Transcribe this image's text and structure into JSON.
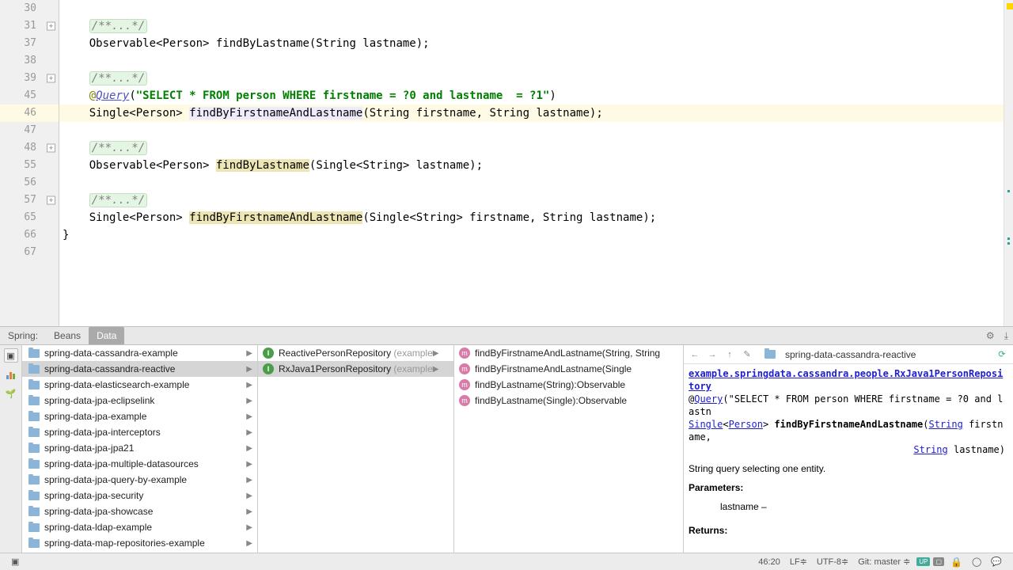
{
  "gutter": {
    "lines": [
      {
        "n": "30",
        "fold": false
      },
      {
        "n": "31",
        "fold": true
      },
      {
        "n": "37",
        "fold": false
      },
      {
        "n": "38",
        "fold": false
      },
      {
        "n": "39",
        "fold": true
      },
      {
        "n": "45",
        "fold": false
      },
      {
        "n": "46",
        "fold": false,
        "lit": true,
        "bulb": true
      },
      {
        "n": "47",
        "fold": false
      },
      {
        "n": "48",
        "fold": true
      },
      {
        "n": "55",
        "fold": false
      },
      {
        "n": "56",
        "fold": false
      },
      {
        "n": "57",
        "fold": true
      },
      {
        "n": "65",
        "fold": false
      },
      {
        "n": "66",
        "fold": false
      },
      {
        "n": "67",
        "fold": false
      }
    ]
  },
  "code": {
    "fold_comment": "/**...*/",
    "l37": "Observable<Person> findByLastname(String lastname);",
    "l45_ann": "@",
    "l45_q": "Query",
    "l45_paren": "(",
    "l45_str": "\"SELECT * FROM person WHERE firstname = ?0 and lastname  = ?1\"",
    "l45_close": ")",
    "l46_pre": "Single<Person> ",
    "l46_m": "findByFirstnameAndLastname",
    "l46_post": "(String firstname, String lastname);",
    "l55_pre": "Observable<Person> ",
    "l55_m": "findByLastname",
    "l55_post": "(Single<String> lastname);",
    "l65_pre": "Single<Person> ",
    "l65_m": "findByFirstnameAndLastname",
    "l65_post": "(Single<String> firstname, String lastname);",
    "l66": "}",
    "indent": "    "
  },
  "tabs": {
    "spring": "Spring:",
    "beans": "Beans",
    "data": "Data"
  },
  "tree": [
    "spring-data-cassandra-example",
    "spring-data-cassandra-reactive",
    "spring-data-elasticsearch-example",
    "spring-data-jpa-eclipselink",
    "spring-data-jpa-example",
    "spring-data-jpa-interceptors",
    "spring-data-jpa-jpa21",
    "spring-data-jpa-multiple-datasources",
    "spring-data-jpa-query-by-example",
    "spring-data-jpa-security",
    "spring-data-jpa-showcase",
    "spring-data-ldap-example",
    "spring-data-map-repositories-example"
  ],
  "mid": [
    {
      "name": "ReactivePersonRepository",
      "suffix": " (example"
    },
    {
      "name": "RxJava1PersonRepository",
      "suffix": " (example"
    }
  ],
  "methods": [
    "findByFirstnameAndLastname(String, String",
    "findByFirstnameAndLastname(Single<String",
    "findByLastname(String):Observable<Person",
    "findByLastname(Single<String>):Observable"
  ],
  "doc": {
    "breadcrumb": "spring-data-cassandra-reactive",
    "fqn": "example.springdata.cassandra.people.RxJava1PersonRepository",
    "ann_at": "@",
    "ann_q": "Query",
    "ann_open": "(",
    "ann_str": "\"SELECT * FROM person WHERE firstname = ?0 and lastn",
    "sig_single": "Single",
    "sig_lt": "<",
    "sig_person": "Person",
    "sig_gt": "> ",
    "sig_method": "findByFirstnameAndLastname",
    "sig_open": "(",
    "sig_string": "String",
    "sig_p1": " firstname,",
    "sig_p2": " lastname)",
    "desc": "String query selecting one entity.",
    "params_h": "Parameters:",
    "param1": "lastname –",
    "returns_h": "Returns:"
  },
  "status": {
    "pos": "46:20",
    "lf": "LF≑",
    "enc": "UTF-8≑",
    "git": "Git: master ≑"
  }
}
